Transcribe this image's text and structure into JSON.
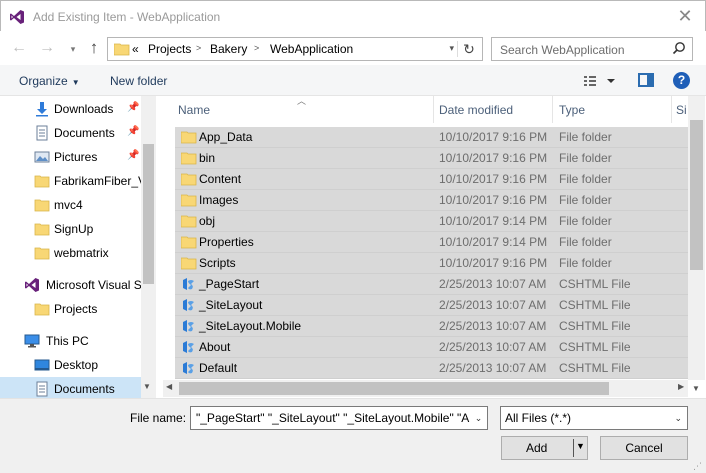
{
  "window": {
    "title": "Add Existing Item - WebApplication",
    "close_glyph": "✕"
  },
  "navigation": {
    "back_glyph": "←",
    "forward_glyph": "→",
    "recent_glyph": "▾",
    "up_glyph": "↑"
  },
  "address": {
    "overflow": "«",
    "crumbs": [
      "Projects",
      "Bakery",
      "WebApplication"
    ],
    "refresh_glyph": "↻"
  },
  "search": {
    "placeholder": "Search WebApplication",
    "icon": "search-icon"
  },
  "toolbar": {
    "organize_label": "Organize",
    "new_folder_label": "New folder",
    "help_label": "?"
  },
  "sidebar": {
    "items": [
      {
        "label": "Downloads",
        "icon": "download-icon",
        "pinned": true
      },
      {
        "label": "Documents",
        "icon": "documents-icon",
        "pinned": true
      },
      {
        "label": "Pictures",
        "icon": "pictures-icon",
        "pinned": true
      },
      {
        "label": "FabrikamFiber_V",
        "icon": "folder-icon",
        "pinned": false
      },
      {
        "label": "mvc4",
        "icon": "folder-icon",
        "pinned": false
      },
      {
        "label": "SignUp",
        "icon": "folder-icon",
        "pinned": false
      },
      {
        "label": "webmatrix",
        "icon": "folder-icon",
        "pinned": false
      },
      {
        "label": "Microsoft Visual S",
        "icon": "visual-studio-icon",
        "pinned": false
      },
      {
        "label": "Projects",
        "icon": "folder-icon",
        "pinned": false
      },
      {
        "label": "This PC",
        "icon": "this-pc-icon",
        "pinned": false
      },
      {
        "label": "Desktop",
        "icon": "desktop-icon",
        "pinned": false
      },
      {
        "label": "Documents",
        "icon": "documents-icon",
        "pinned": false,
        "selected": true
      }
    ]
  },
  "filelist": {
    "columns": [
      "Name",
      "Date modified",
      "Type",
      "Si"
    ],
    "rows": [
      {
        "name": "App_Data",
        "date": "10/10/2017 9:16 PM",
        "type": "File folder",
        "kind": "folder"
      },
      {
        "name": "bin",
        "date": "10/10/2017 9:16 PM",
        "type": "File folder",
        "kind": "folder"
      },
      {
        "name": "Content",
        "date": "10/10/2017 9:16 PM",
        "type": "File folder",
        "kind": "folder"
      },
      {
        "name": "Images",
        "date": "10/10/2017 9:16 PM",
        "type": "File folder",
        "kind": "folder"
      },
      {
        "name": "obj",
        "date": "10/10/2017 9:14 PM",
        "type": "File folder",
        "kind": "folder"
      },
      {
        "name": "Properties",
        "date": "10/10/2017 9:14 PM",
        "type": "File folder",
        "kind": "folder"
      },
      {
        "name": "Scripts",
        "date": "10/10/2017 9:16 PM",
        "type": "File folder",
        "kind": "folder"
      },
      {
        "name": "_PageStart",
        "date": "2/25/2013 10:07 AM",
        "type": "CSHTML File",
        "kind": "cshtml"
      },
      {
        "name": "_SiteLayout",
        "date": "2/25/2013 10:07 AM",
        "type": "CSHTML File",
        "kind": "cshtml"
      },
      {
        "name": "_SiteLayout.Mobile",
        "date": "2/25/2013 10:07 AM",
        "type": "CSHTML File",
        "kind": "cshtml"
      },
      {
        "name": "About",
        "date": "2/25/2013 10:07 AM",
        "type": "CSHTML File",
        "kind": "cshtml"
      },
      {
        "name": "Default",
        "date": "2/25/2013 10:07 AM",
        "type": "CSHTML File",
        "kind": "cshtml"
      }
    ]
  },
  "footer": {
    "file_name_label": "File name:",
    "file_name_value": "\"_PageStart\" \"_SiteLayout\" \"_SiteLayout.Mobile\" \"Ab",
    "filter_value": "All Files (*.*)",
    "add_label": "Add",
    "cancel_label": "Cancel"
  },
  "colors": {
    "selection_row": "#d9d9d9",
    "nav_selected": "#cce4f7",
    "accent_blue": "#1f5fb8",
    "folder_yellow": "#f8d775",
    "vs_purple": "#68217a"
  }
}
